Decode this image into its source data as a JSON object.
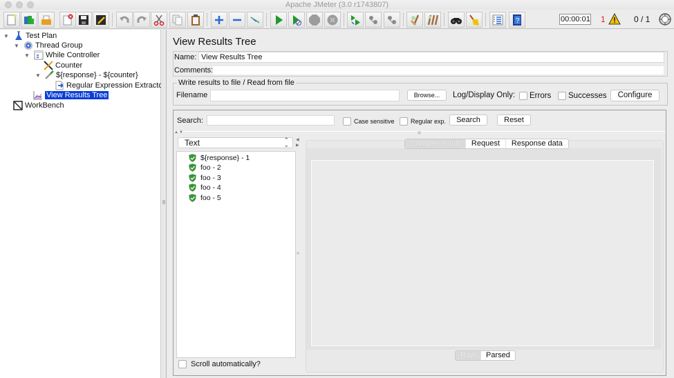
{
  "window": {
    "title": "Apache JMeter (3.0 r1743807)"
  },
  "toolbar": {
    "buttons": [
      {
        "name": "new-icon",
        "tooltip": "New"
      },
      {
        "name": "templates-icon",
        "tooltip": "Templates"
      },
      {
        "name": "open-icon",
        "tooltip": "Open"
      },
      {
        "name": "close-icon",
        "tooltip": "Close"
      },
      {
        "name": "save-icon",
        "tooltip": "Save"
      },
      {
        "name": "save-as-icon",
        "tooltip": "Save as"
      },
      {
        "name": "undo-icon",
        "tooltip": "Undo"
      },
      {
        "name": "redo-icon",
        "tooltip": "Redo"
      },
      {
        "name": "cut-icon",
        "tooltip": "Cut"
      },
      {
        "name": "copy-icon",
        "tooltip": "Copy"
      },
      {
        "name": "paste-icon",
        "tooltip": "Paste"
      },
      {
        "name": "expand-icon",
        "tooltip": "Expand all"
      },
      {
        "name": "collapse-icon",
        "tooltip": "Collapse all"
      },
      {
        "name": "toggle-icon",
        "tooltip": "Toggle"
      },
      {
        "name": "start-icon",
        "tooltip": "Start"
      },
      {
        "name": "start-no-timers-icon",
        "tooltip": "Start no pauses"
      },
      {
        "name": "stop-icon",
        "tooltip": "Stop"
      },
      {
        "name": "shutdown-icon",
        "tooltip": "Shutdown"
      },
      {
        "name": "remote-start-icon",
        "tooltip": "Remote start all"
      },
      {
        "name": "remote-stop-icon",
        "tooltip": "Remote stop all"
      },
      {
        "name": "remote-shutdown-icon",
        "tooltip": "Remote shutdown all"
      },
      {
        "name": "clear-icon",
        "tooltip": "Clear"
      },
      {
        "name": "clear-all-icon",
        "tooltip": "Clear all"
      },
      {
        "name": "search-icon",
        "tooltip": "Search"
      },
      {
        "name": "reset-search-icon",
        "tooltip": "Reset search"
      },
      {
        "name": "function-helper-icon",
        "tooltip": "Function helper"
      },
      {
        "name": "help-icon",
        "tooltip": "Help"
      }
    ],
    "timer": "00:00:01",
    "error_count": "1",
    "threads": "0 / 1"
  },
  "tree": {
    "items": [
      {
        "label": "Test Plan",
        "level": 0,
        "expanded": true,
        "icon": "test-plan-icon"
      },
      {
        "label": "Thread Group",
        "level": 1,
        "expanded": true,
        "icon": "thread-group-icon"
      },
      {
        "label": "While Controller",
        "level": 2,
        "expanded": true,
        "icon": "while-controller-icon"
      },
      {
        "label": "Counter",
        "level": 3,
        "expanded": null,
        "icon": "counter-icon"
      },
      {
        "label": "${response} - ${counter}",
        "level": 3,
        "expanded": true,
        "icon": "sampler-icon"
      },
      {
        "label": "Regular Expression Extractor",
        "level": 4,
        "expanded": null,
        "icon": "extractor-icon"
      },
      {
        "label": "View Results Tree",
        "level": 2,
        "expanded": null,
        "icon": "listener-icon",
        "selected": true
      },
      {
        "label": "WorkBench",
        "level": 0,
        "expanded": null,
        "icon": "workbench-icon"
      }
    ]
  },
  "main": {
    "title": "View Results Tree",
    "name_label": "Name:",
    "name_value": "View Results Tree",
    "comments_label": "Comments:",
    "comments_value": "",
    "file_group_title": "Write results to file / Read from file",
    "filename_label": "Filename",
    "filename_value": "",
    "browse_label": "Browse...",
    "log_display_label": "Log/Display Only:",
    "errors_label": "Errors",
    "errors_checked": false,
    "successes_label": "Successes",
    "successes_checked": false,
    "configure_label": "Configure"
  },
  "search": {
    "label": "Search:",
    "value": "",
    "case_sensitive_label": "Case sensitive",
    "case_sensitive_checked": false,
    "regex_label": "Regular exp.",
    "regex_checked": false,
    "search_button": "Search",
    "reset_button": "Reset"
  },
  "results": {
    "renderer": "Text",
    "items": [
      {
        "label": "${response} - 1",
        "status": "success"
      },
      {
        "label": "foo - 2",
        "status": "success"
      },
      {
        "label": "foo - 3",
        "status": "success"
      },
      {
        "label": "foo - 4",
        "status": "success"
      },
      {
        "label": "foo - 5",
        "status": "success"
      }
    ],
    "scroll_auto_label": "Scroll automatically?",
    "scroll_auto_checked": false
  },
  "detail": {
    "tabs": [
      {
        "label": "Sampler result",
        "active": true
      },
      {
        "label": "Request",
        "active": false
      },
      {
        "label": "Response data",
        "active": false
      }
    ],
    "subtabs": [
      {
        "label": "Raw",
        "active": true
      },
      {
        "label": "Parsed",
        "active": false
      }
    ]
  },
  "colors": {
    "selection": "#0a3fd6",
    "success": "#2e9a2e",
    "error_count": "#e02020",
    "warning": "#f2c200"
  }
}
